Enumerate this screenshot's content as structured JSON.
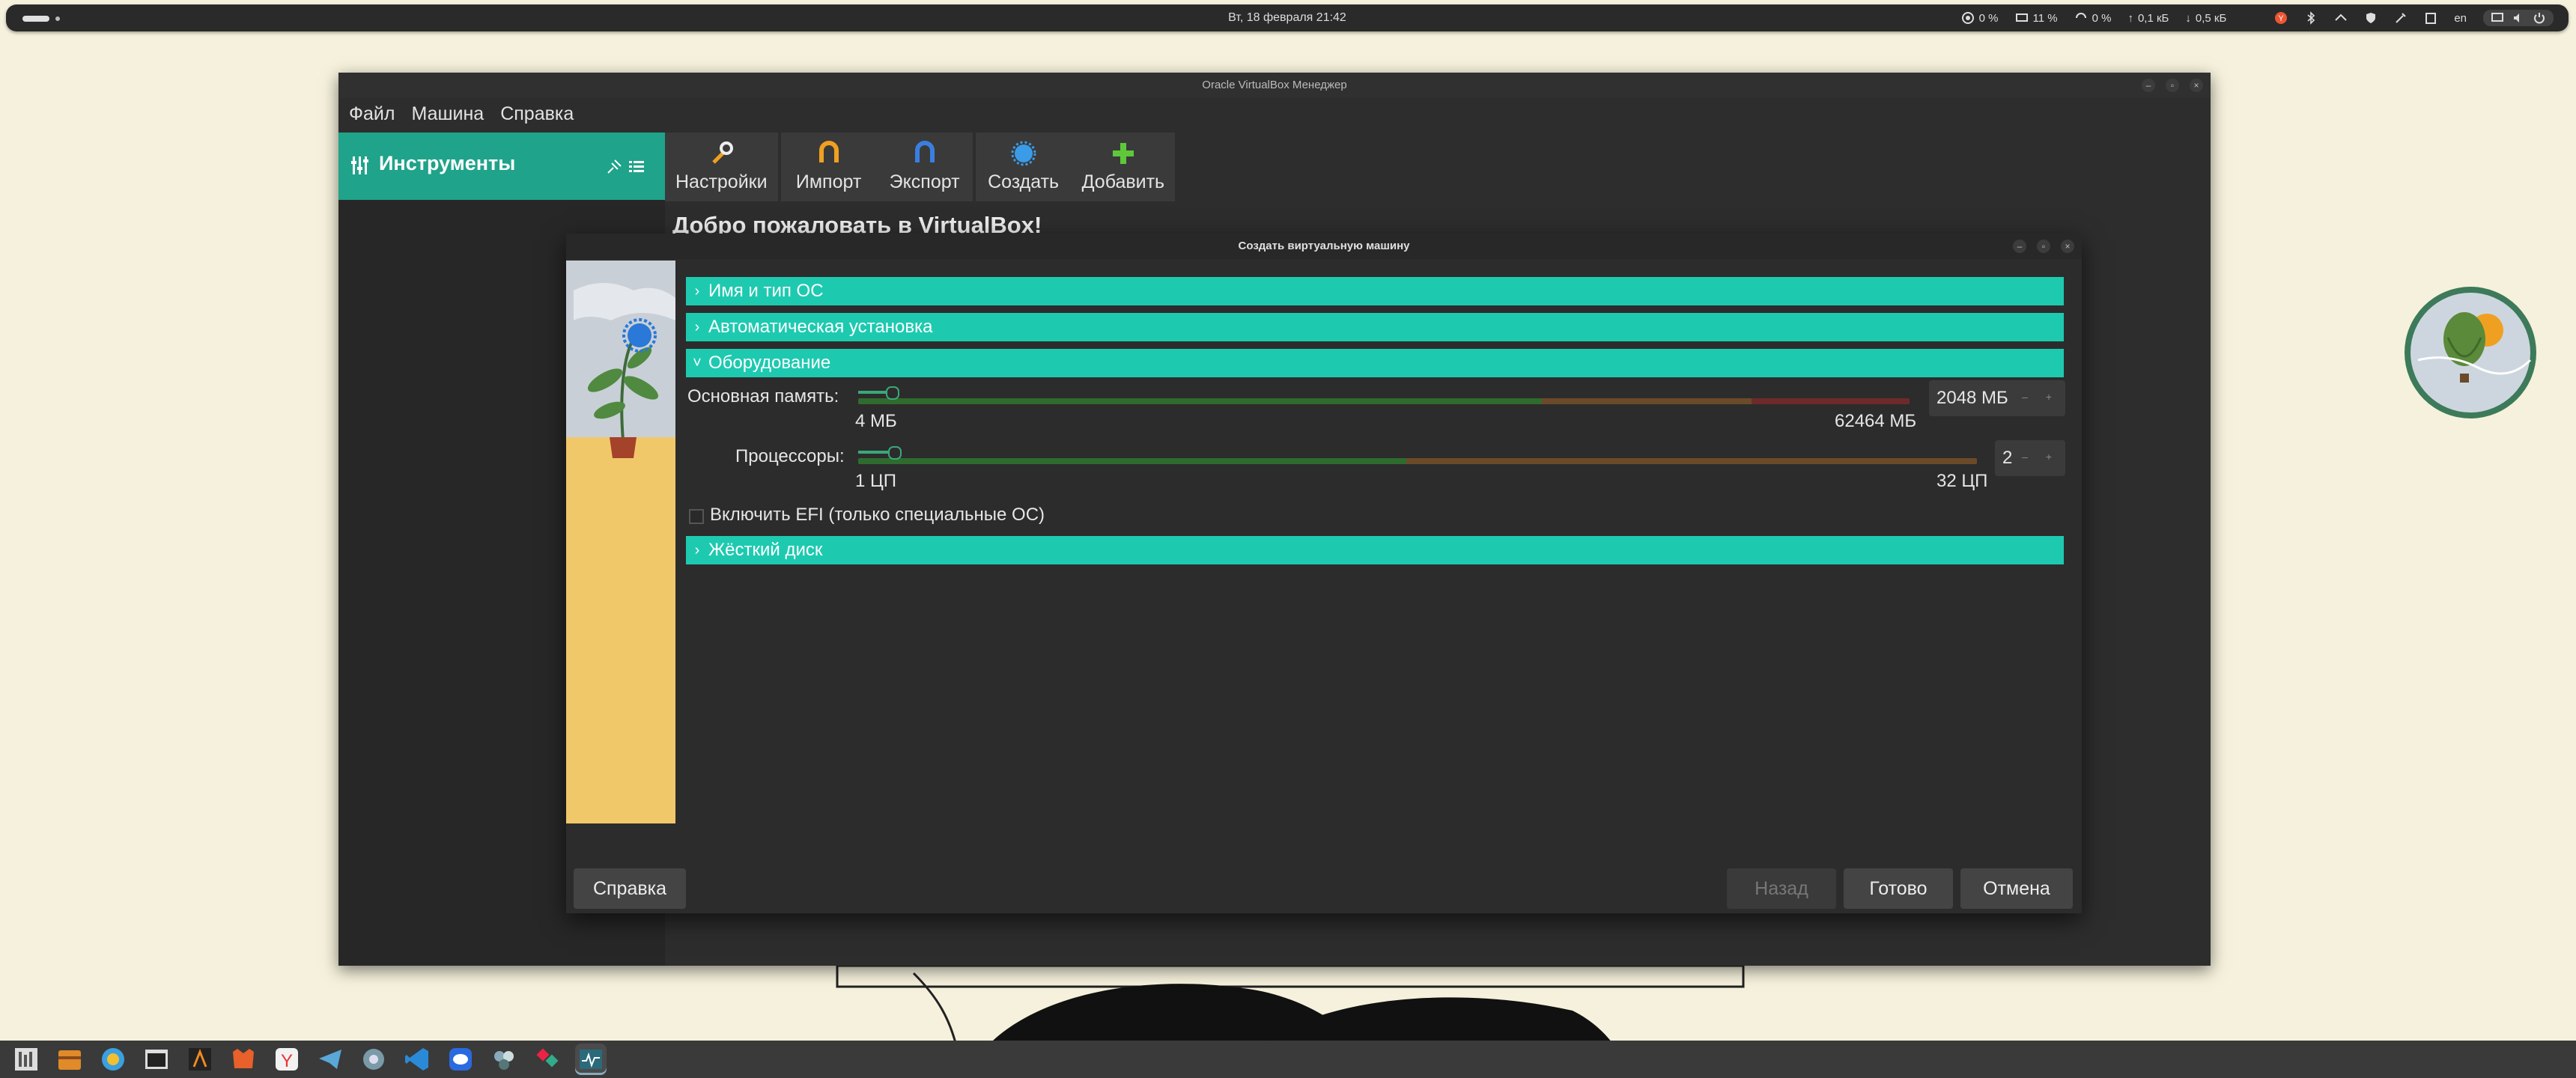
{
  "topbar": {
    "clock": "Вт, 18 февраля  21:42",
    "cpu": "0 %",
    "mem": "11 %",
    "swap": "0 %",
    "upload": "0,1 кБ",
    "download": "0,5 кБ",
    "lang": "en"
  },
  "vbox": {
    "title": "Oracle VirtualBox Менеджер",
    "menu": [
      "Файл",
      "Машина",
      "Справка"
    ],
    "tools_label": "Инструменты",
    "toolbar": [
      {
        "label": "Настройки",
        "icon": "settings-wrench-icon"
      },
      {
        "label": "Импорт",
        "icon": "import-icon"
      },
      {
        "label": "Экспорт",
        "icon": "export-icon"
      },
      {
        "label": "Создать",
        "icon": "create-icon"
      },
      {
        "label": "Добавить",
        "icon": "add-icon"
      }
    ],
    "welcome": "Добро пожаловать в VirtualBox!"
  },
  "dialog": {
    "title": "Создать виртуальную машину",
    "sections": {
      "name_os": "Имя и тип ОС",
      "unattended": "Автоматическая установка",
      "hardware": "Оборудование",
      "disk": "Жёсткий диск"
    },
    "memory": {
      "label": "Основная память:",
      "min_label": "4 МБ",
      "max_label": "62464 МБ",
      "value": "2048 МБ",
      "fraction": 0.032
    },
    "cpu": {
      "label": "Процессоры:",
      "min_label": "1 ЦП",
      "max_label": "32 ЦП",
      "value": "2",
      "fraction": 0.032
    },
    "efi": {
      "label": "Включить EFI (только специальные ОС)",
      "checked": false
    },
    "buttons": {
      "help": "Справка",
      "back": "Назад",
      "finish": "Готово",
      "cancel": "Отмена"
    }
  },
  "dock": [
    "files",
    "archive",
    "browser",
    "terminal",
    "code-editor",
    "firefox",
    "yandex-browser",
    "telegram",
    "app",
    "vscode",
    "messenger",
    "app2",
    "app3",
    "system-monitor"
  ]
}
